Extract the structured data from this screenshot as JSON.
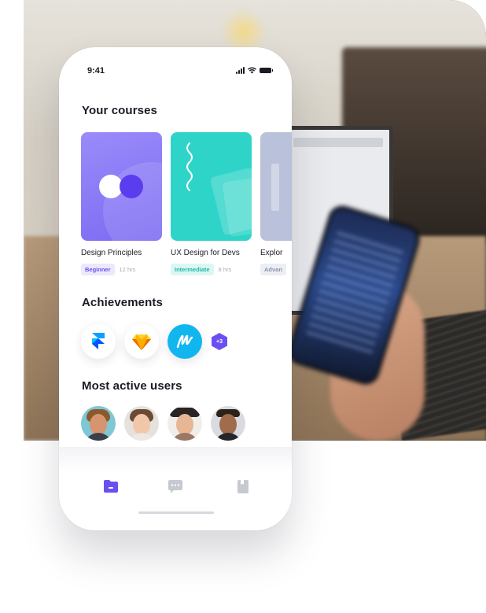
{
  "status_bar": {
    "time": "9:41",
    "icons": [
      "signal-icon",
      "wifi-icon",
      "battery-icon"
    ]
  },
  "courses_section": {
    "title": "Your courses",
    "items": [
      {
        "name": "Design Principles",
        "level": "Beginner",
        "duration": "12 hrs",
        "thumb_color": "#8b7cf6",
        "level_color": "#6c4ff3",
        "level_bg": "#ece9fb"
      },
      {
        "name": "UX Design for Devs",
        "level": "Intermediate",
        "duration": "8 hrs",
        "thumb_color": "#2fd4c8",
        "level_color": "#1fb8ab",
        "level_bg": "#ddf6f3"
      },
      {
        "name": "Explor",
        "level": "Advan",
        "duration": "",
        "thumb_color": "#b9c2da",
        "level_color": "#8a93ab",
        "level_bg": "#eceef4"
      }
    ]
  },
  "achievements_section": {
    "title": "Achievements",
    "badges": [
      "framer-icon",
      "sketch-icon",
      "marvel-icon"
    ],
    "more_count": "+3"
  },
  "users_section": {
    "title": "Most active users",
    "avatars": [
      "avatar-1",
      "avatar-2",
      "avatar-3",
      "avatar-4"
    ]
  },
  "tab_bar": {
    "tabs": [
      "folder-icon",
      "chat-icon",
      "bookmark-icon"
    ],
    "active_color": "#6c4ff3",
    "inactive_color": "#c7c9d1"
  }
}
